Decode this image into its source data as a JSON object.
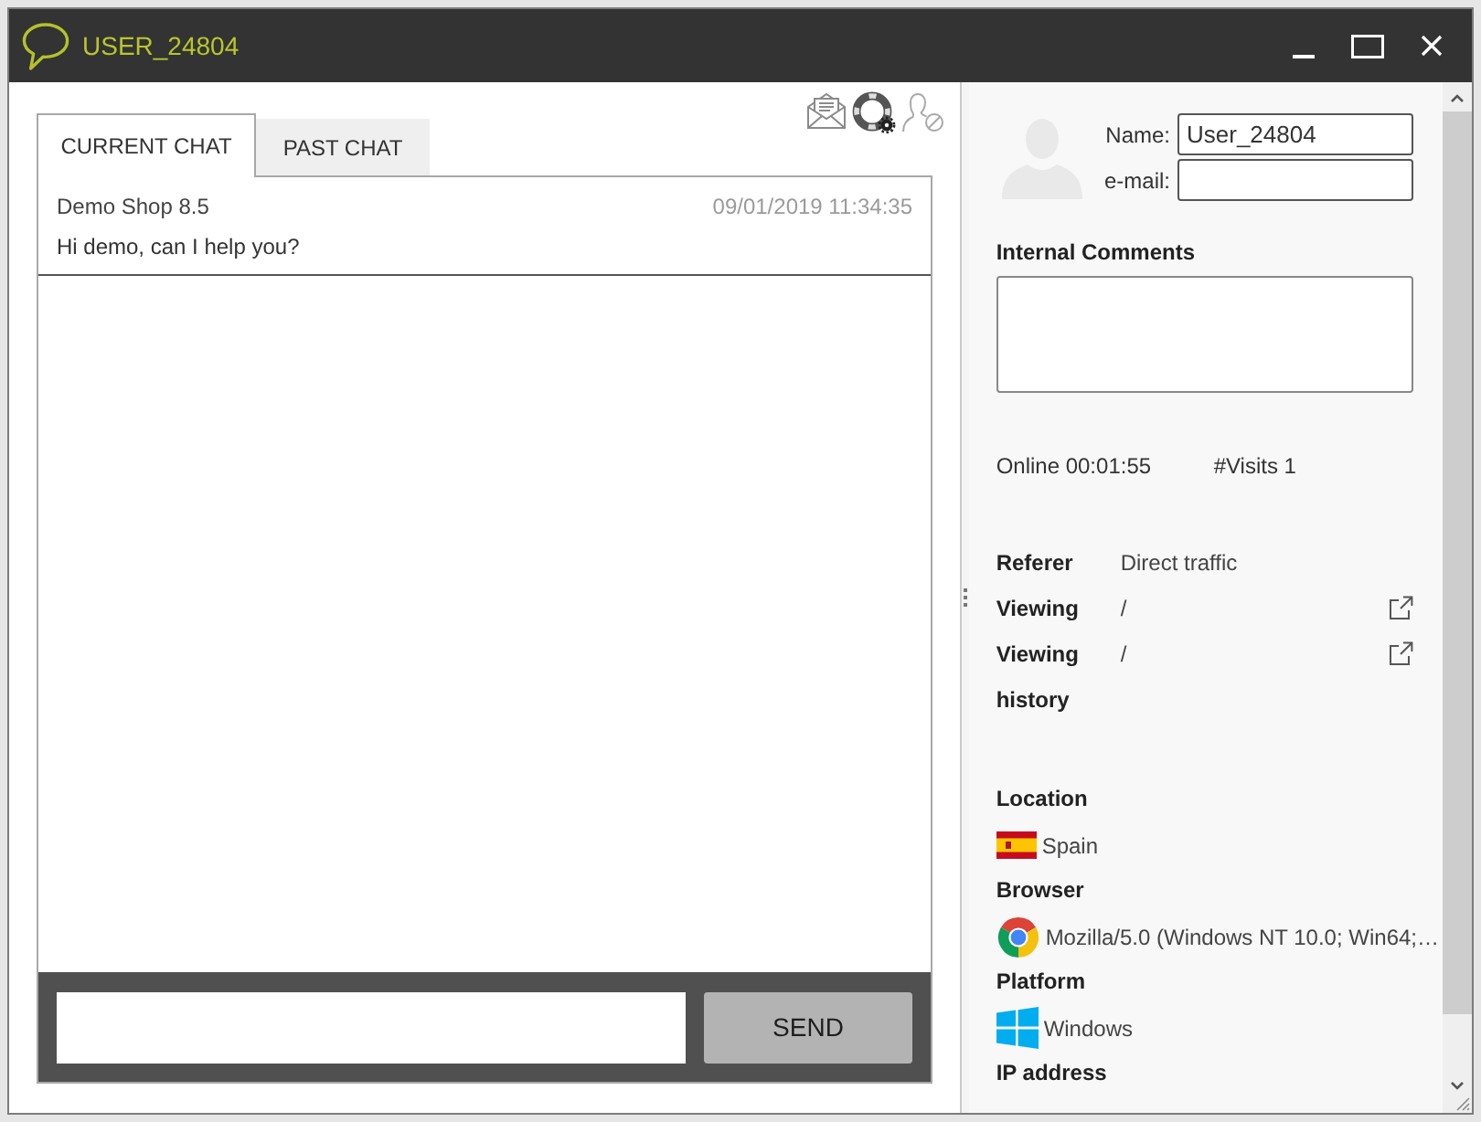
{
  "window": {
    "title": "USER_24804"
  },
  "tabs": [
    {
      "label": "CURRENT CHAT",
      "selected": true
    },
    {
      "label": "PAST CHAT",
      "selected": false
    }
  ],
  "messages": [
    {
      "sender": "Demo Shop 8.5",
      "time": "09/01/2019 11:34:35",
      "text": "Hi demo, can I help you?"
    }
  ],
  "composer": {
    "send_button": "SEND"
  },
  "visitor": {
    "name_label": "Name:",
    "name_value": "User_24804",
    "email_label": "e-mail:"
  },
  "comments": {
    "label": "Internal Comments"
  },
  "stats": [
    "Online 00:01:55",
    "#Visits 1"
  ],
  "details": [
    {
      "label": "Referer",
      "value": "Direct traffic",
      "link": false
    },
    {
      "label": "Viewing",
      "value": "/",
      "link": true
    },
    {
      "label": "Viewing history",
      "value": "/",
      "link": true
    }
  ],
  "info": [
    {
      "label": "Location",
      "kind": "flag",
      "value": "Spain"
    },
    {
      "label": "Browser",
      "kind": "browser",
      "value": "Mozilla/5.0 (Windows NT 10.0; Win64;…"
    },
    {
      "label": "Platform",
      "kind": "platform",
      "value": "Windows"
    },
    {
      "label": "IP address",
      "kind": "none"
    }
  ]
}
